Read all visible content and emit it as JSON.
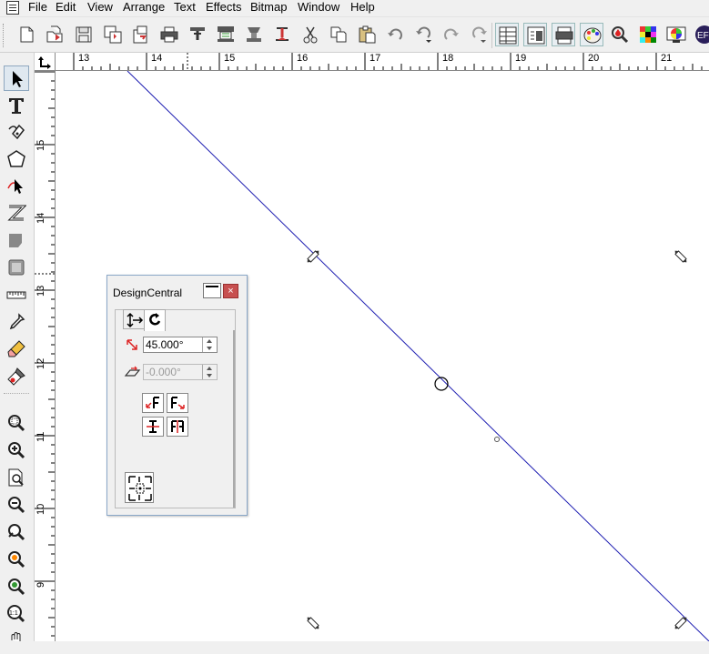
{
  "menu": {
    "items": [
      "File",
      "Edit",
      "View",
      "Arrange",
      "Text",
      "Effects",
      "Bitmap",
      "Window",
      "Help"
    ]
  },
  "toolbar": {
    "icons": [
      "new-document-icon",
      "open-icon",
      "save-icon",
      "save-as-icon",
      "import-icon",
      "print-icon",
      "plot-icon",
      "cut-plot-icon",
      "vinyl-icon",
      "weed-icon",
      "scissors-icon",
      "copy-icon",
      "paste-icon",
      "undo-icon",
      "undo-multi-icon",
      "redo-icon",
      "redo-multi-icon",
      "table-icon",
      "properties-icon",
      "production-icon",
      "color-palette-icon",
      "ink-drop-icon",
      "color-grid-icon",
      "color-wheel-icon",
      "ef-icon"
    ],
    "ef_label": "EF"
  },
  "ruler": {
    "horizontal": [
      "13",
      "14",
      "15",
      "16",
      "17",
      "18",
      "19",
      "20",
      "21"
    ],
    "vertical": [
      "15",
      "14",
      "13",
      "12",
      "11",
      "10",
      "9"
    ]
  },
  "toolbox": {
    "tools": [
      "pointer-tool-icon",
      "text-tool-icon",
      "pen-tool-icon",
      "shape-tool-icon",
      "node-tool-icon",
      "zigzag-tool-icon",
      "fill-tool-icon",
      "outline-tool-icon",
      "measure-tool-icon",
      "eyedropper-tool-icon",
      "eraser-tool-icon",
      "knife-tool-icon",
      "zoom-tool-icon",
      "zoom-in-icon",
      "zoom-page-icon",
      "zoom-out-icon",
      "zoom-fit-icon",
      "zoom-selection-icon",
      "zoom-all-icon",
      "zoom-actual-icon",
      "pan-tool-icon"
    ]
  },
  "design_central": {
    "title": "DesignCentral",
    "close_label": "×",
    "rotation_angle": "45.000°",
    "slant_angle": "-0.000°",
    "tabs": [
      "move-tab",
      "rotate-tab"
    ]
  },
  "colors": {
    "line": "#1a1ab0",
    "canvas": "#ffffff",
    "chrome": "#f0f0f0",
    "close_button": "#c75050"
  }
}
